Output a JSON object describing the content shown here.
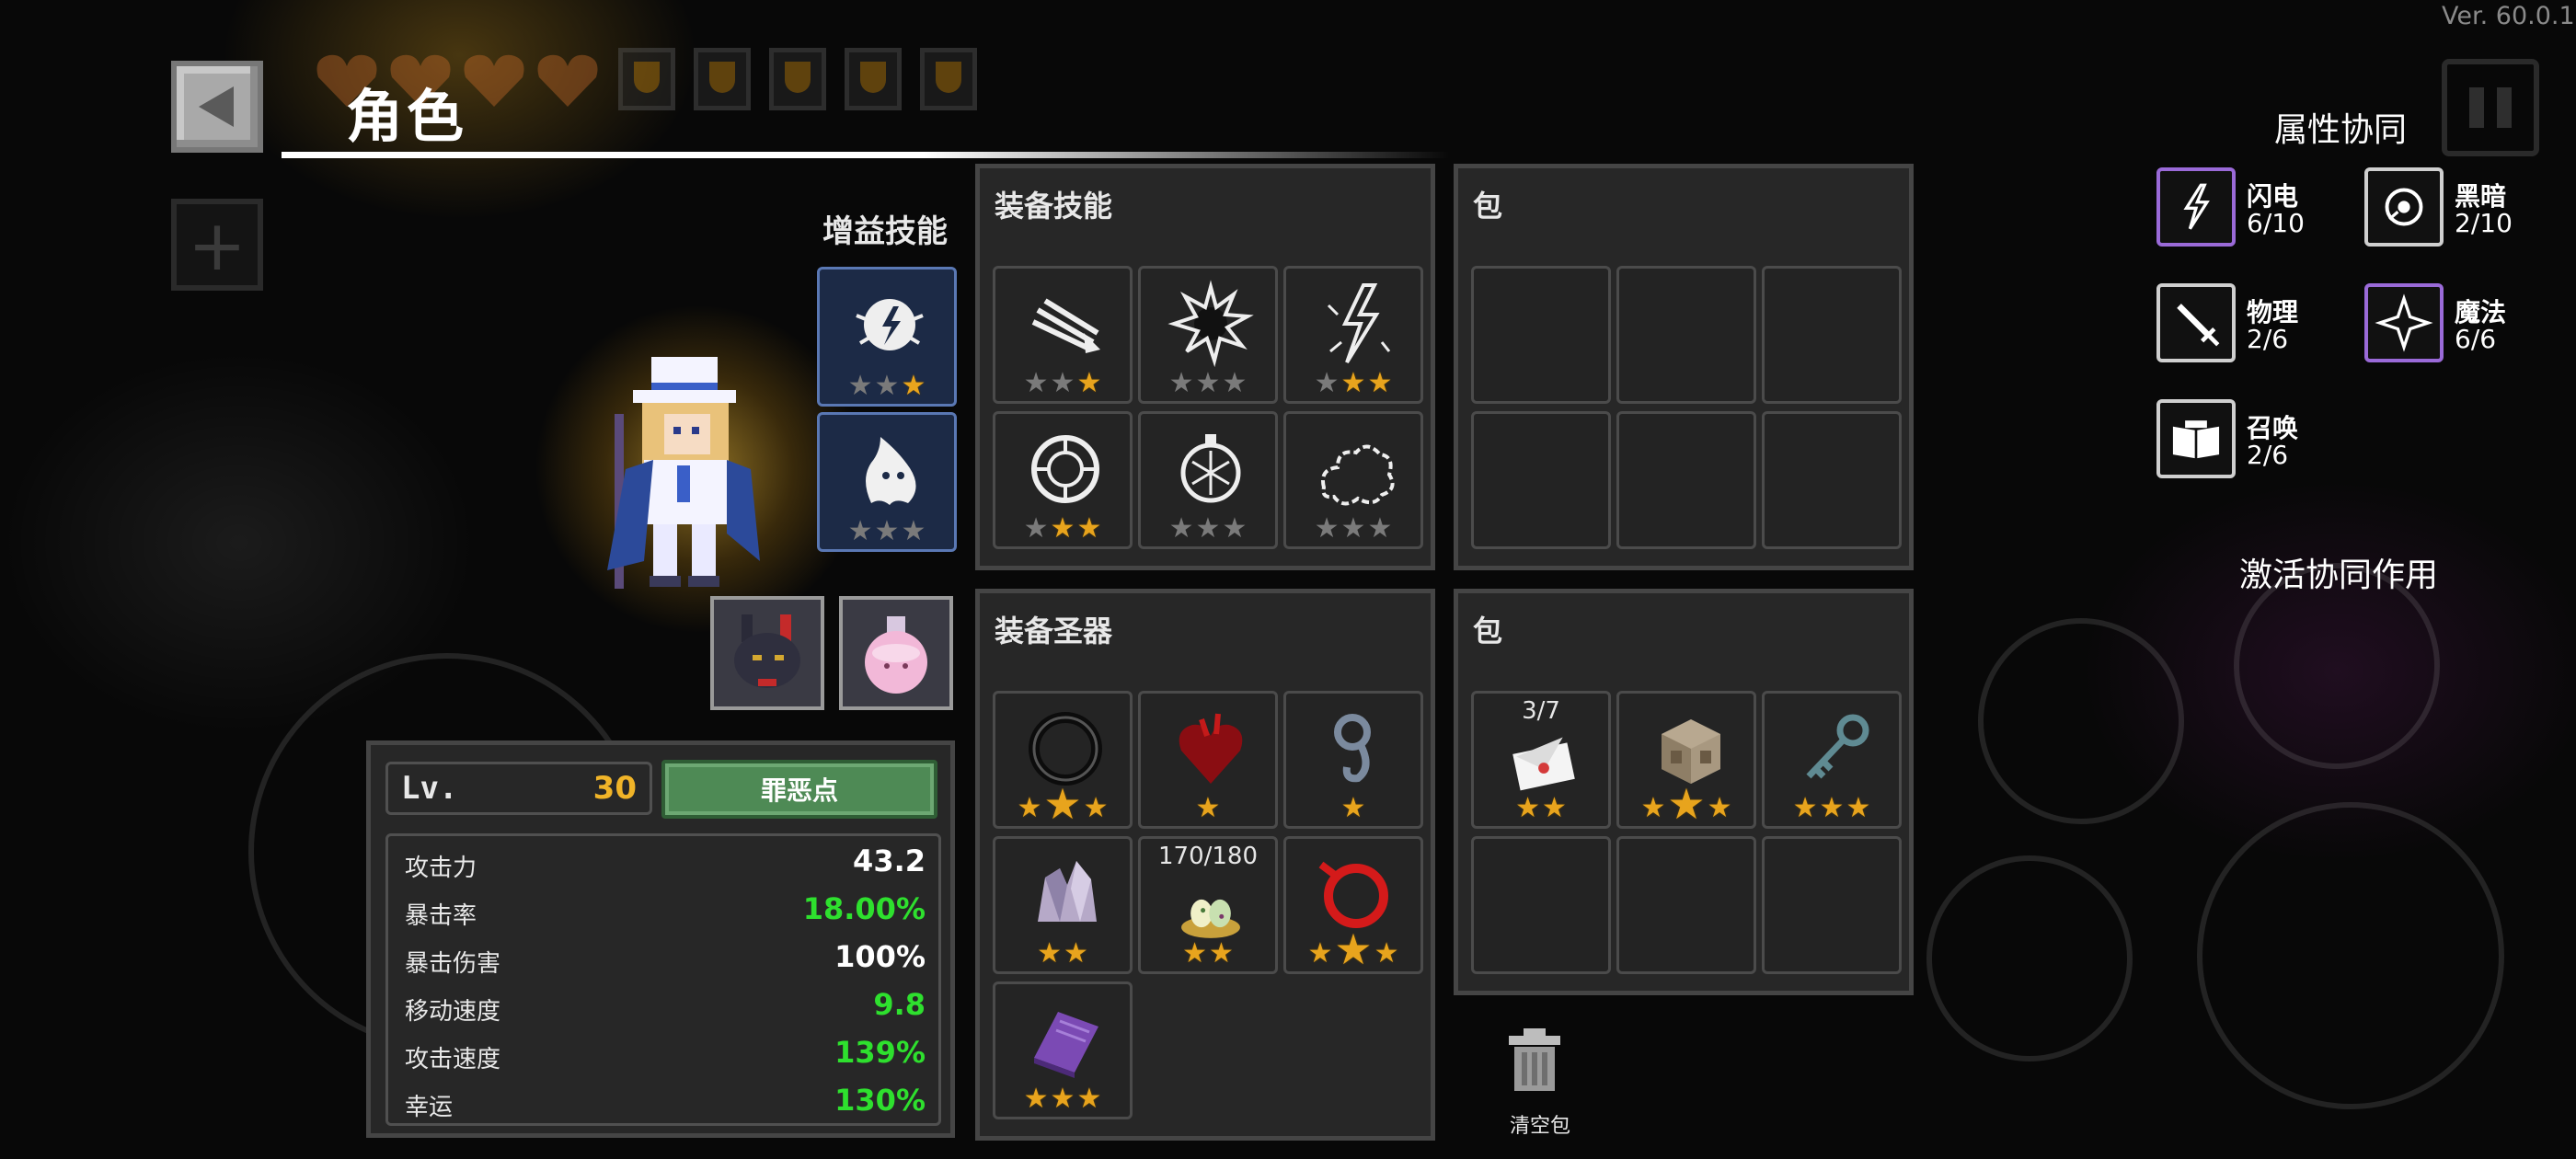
{
  "version": "Ver. 60.0.1",
  "header": {
    "title": "角色"
  },
  "hud": {
    "hearts": 4,
    "shields": 5
  },
  "buff_skills": {
    "title": "增益技能",
    "slots": [
      {
        "icon": "lightning-orb-icon",
        "stars": 3,
        "filled": 1
      },
      {
        "icon": "ghost-flame-icon",
        "stars": 3,
        "filled": 0
      }
    ]
  },
  "companions": [
    {
      "icon": "black-bunny-pet-icon"
    },
    {
      "icon": "pink-potion-pet-icon"
    }
  ],
  "equip_skills": {
    "title": "装备技能",
    "slots": [
      {
        "icon": "claw-slash-icon",
        "stars": 3,
        "filled": 1,
        "big": 0
      },
      {
        "icon": "dark-burst-icon",
        "stars": 3,
        "filled": 0,
        "big": 0
      },
      {
        "icon": "lightning-bolt-icon",
        "stars": 3,
        "filled": 2,
        "big": 0
      },
      {
        "icon": "wind-ring-icon",
        "stars": 3,
        "filled": 2,
        "big": 0
      },
      {
        "icon": "frost-orb-icon",
        "stars": 3,
        "filled": 0,
        "big": 0
      },
      {
        "icon": "smoke-cloud-icon",
        "stars": 3,
        "filled": 0,
        "big": 0
      }
    ]
  },
  "skill_bag": {
    "title": "包",
    "slots": 6
  },
  "equip_relics": {
    "title": "装备圣器",
    "slots": [
      {
        "icon": "dark-ring-icon",
        "stars": 3,
        "big": 1,
        "counter": null
      },
      {
        "icon": "blood-heart-icon",
        "stars": 1,
        "big": 0,
        "counter": null
      },
      {
        "icon": "iron-hook-icon",
        "stars": 1,
        "big": 0,
        "counter": null
      },
      {
        "icon": "crystal-rock-icon",
        "stars": 2,
        "big": 0,
        "counter": null
      },
      {
        "icon": "egg-nest-icon",
        "stars": 2,
        "big": 0,
        "counter": "170/180"
      },
      {
        "icon": "red-rope-icon",
        "stars": 3,
        "big": 1,
        "counter": null
      },
      {
        "icon": "purple-book-icon",
        "stars": 3,
        "big": 0,
        "counter": null
      }
    ]
  },
  "relic_bag": {
    "title": "包",
    "slots": [
      {
        "icon": "letter-envelope-icon",
        "stars": 2,
        "big": 0,
        "counter": "3/7"
      },
      {
        "icon": "stone-cube-icon",
        "stars": 3,
        "big": 1,
        "counter": null
      },
      {
        "icon": "old-key-icon",
        "stars": 3,
        "big": 0,
        "counter": null
      }
    ],
    "empty_slots": 3
  },
  "stats": {
    "level_label": "Lv.",
    "level": "30",
    "sin_button": "罪恶点",
    "rows": [
      {
        "name": "攻击力",
        "value": "43.2",
        "color": "#ffffff"
      },
      {
        "name": "暴击率",
        "value": "18.00%",
        "color": "#2ee02e"
      },
      {
        "name": "暴击伤害",
        "value": "100%",
        "color": "#ffffff"
      },
      {
        "name": "移动速度",
        "value": "9.8",
        "color": "#2ee02e"
      },
      {
        "name": "攻击速度",
        "value": "139%",
        "color": "#2ee02e"
      },
      {
        "name": "幸运",
        "value": "130%",
        "color": "#2ee02e"
      }
    ]
  },
  "synergy": {
    "title": "属性协同",
    "items": [
      {
        "name": "闪电",
        "count": "6/10",
        "icon": "lightning-synergy-icon",
        "active": true
      },
      {
        "name": "黑暗",
        "count": "2/10",
        "icon": "dark-eye-synergy-icon",
        "active": false
      },
      {
        "name": "物理",
        "count": "2/6",
        "icon": "sword-synergy-icon",
        "active": false
      },
      {
        "name": "魔法",
        "count": "6/6",
        "icon": "magic-star-synergy-icon",
        "active": true
      },
      {
        "name": "召唤",
        "count": "2/6",
        "icon": "summon-book-synergy-icon",
        "active": false
      }
    ],
    "activate_label": "激活协同作用"
  },
  "trash": {
    "label": "清空包",
    "icon": "trash-can-icon"
  },
  "colors": {
    "star": "#e8a41d",
    "green": "#2ee02e",
    "level": "#f0b428",
    "purple": "#9a6ad8"
  }
}
